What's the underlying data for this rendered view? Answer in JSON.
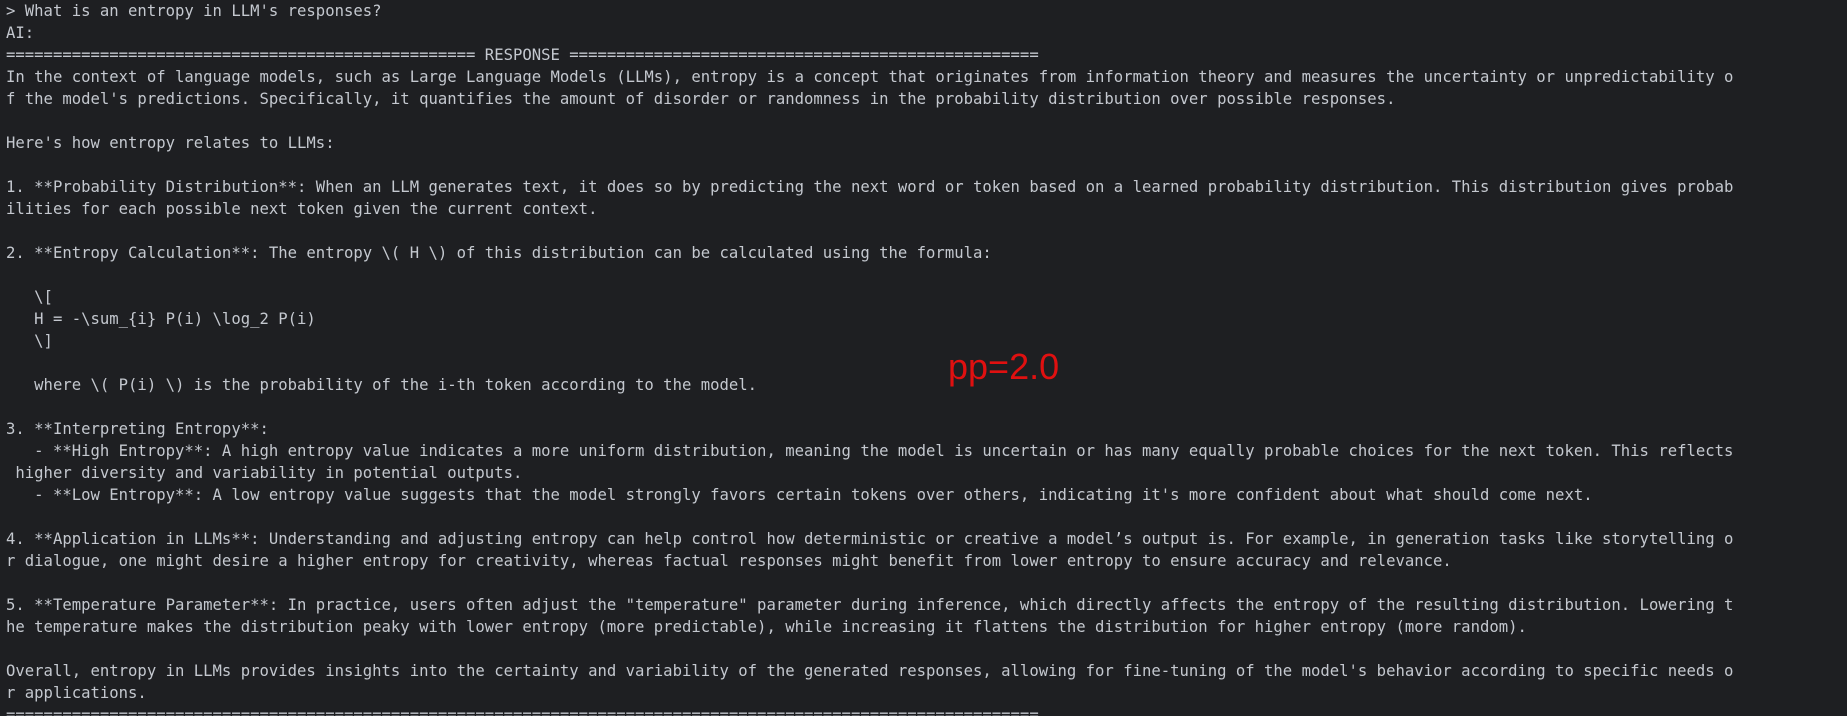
{
  "terminal": {
    "colors": {
      "background": "#1e1f22",
      "text": "#c4c8cf",
      "overlay": "#e01010"
    },
    "lines": [
      "> What is an entropy in LLM's responses?",
      "AI:",
      "================================================== RESPONSE ==================================================",
      "In the context of language models, such as Large Language Models (LLMs), entropy is a concept that originates from information theory and measures the uncertainty or unpredictability o",
      "f the model's predictions. Specifically, it quantifies the amount of disorder or randomness in the probability distribution over possible responses.",
      "",
      "Here's how entropy relates to LLMs:",
      "",
      "1. **Probability Distribution**: When an LLM generates text, it does so by predicting the next word or token based on a learned probability distribution. This distribution gives probab",
      "ilities for each possible next token given the current context.",
      "",
      "2. **Entropy Calculation**: The entropy \\( H \\) of this distribution can be calculated using the formula:",
      "",
      "   \\[",
      "   H = -\\sum_{i} P(i) \\log_2 P(i)",
      "   \\]",
      "",
      "   where \\( P(i) \\) is the probability of the i-th token according to the model.",
      "",
      "3. **Interpreting Entropy**:",
      "   - **High Entropy**: A high entropy value indicates a more uniform distribution, meaning the model is uncertain or has many equally probable choices for the next token. This reflects",
      " higher diversity and variability in potential outputs.",
      "   - **Low Entropy**: A low entropy value suggests that the model strongly favors certain tokens over others, indicating it's more confident about what should come next.",
      "",
      "4. **Application in LLMs**: Understanding and adjusting entropy can help control how deterministic or creative a model’s output is. For example, in generation tasks like storytelling o",
      "r dialogue, one might desire a higher entropy for creativity, whereas factual responses might benefit from lower entropy to ensure accuracy and relevance.",
      "",
      "5. **Temperature Parameter**: In practice, users often adjust the \"temperature\" parameter during inference, which directly affects the entropy of the resulting distribution. Lowering t",
      "he temperature makes the distribution peaky with lower entropy (more predictable), while increasing it flattens the distribution for higher entropy (more random).",
      "",
      "Overall, entropy in LLMs provides insights into the certainty and variability of the generated responses, allowing for fine-tuning of the model's behavior according to specific needs o",
      "r applications.",
      "=============================================================================================================="
    ]
  },
  "overlay": {
    "text": "pp=2.0"
  }
}
